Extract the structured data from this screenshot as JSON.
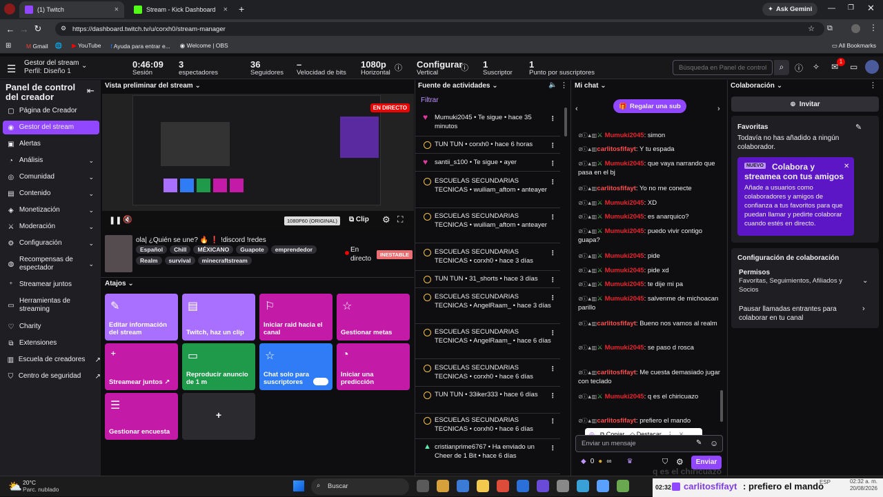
{
  "browser": {
    "tabs": [
      {
        "label": "(1) Twitch"
      },
      {
        "label": "Stream - Kick Dashboard"
      }
    ],
    "new_tab": "+",
    "ask_gemini": "Ask Gemini",
    "url": "https://dashboard.twitch.tv/u/corxh0/stream-manager",
    "bookmarks": [
      "Gmail",
      "YouTube",
      "Ayuda para entrar e...",
      "Welcome | OBS"
    ],
    "all_bookmarks": "All Bookmarks"
  },
  "topbar": {
    "title": "Gestor del stream",
    "profile": "Perfil: Diseño 1",
    "stats": [
      {
        "value": "0:46:09",
        "label": "Sesión"
      },
      {
        "value": "3",
        "label": "espectadores"
      },
      {
        "value": "36",
        "label": "Seguidores"
      },
      {
        "value": "–",
        "label": "Velocidad de bits"
      },
      {
        "value": "1080p",
        "label": "Horizontal"
      },
      {
        "value": "Configurar",
        "label": "Vertical"
      },
      {
        "value": "1",
        "label": "Suscriptor"
      },
      {
        "value": "1",
        "label": "Punto por suscriptores"
      }
    ],
    "search_placeholder": "Búsqueda en Panel de control",
    "notif_count": "1"
  },
  "sidebar": {
    "title": "Panel de control del creador",
    "items": [
      {
        "label": "Página de Creador",
        "icon": "home-icon"
      },
      {
        "label": "Gestor del stream",
        "icon": "broadcast-icon",
        "active": true
      },
      {
        "label": "Alertas",
        "icon": "alert-icon"
      },
      {
        "label": "Análisis",
        "icon": "chart-icon",
        "chevron": true
      },
      {
        "label": "Comunidad",
        "icon": "community-icon",
        "chevron": true
      },
      {
        "label": "Contenido",
        "icon": "content-icon",
        "chevron": true
      },
      {
        "label": "Monetización",
        "icon": "money-icon",
        "chevron": true
      },
      {
        "label": "Moderación",
        "icon": "sword-icon",
        "chevron": true
      },
      {
        "label": "Configuración",
        "icon": "gear-icon",
        "chevron": true
      },
      {
        "label": "Recompensas de espectador",
        "icon": "reward-icon",
        "chevron": true
      },
      {
        "label": "Streamear juntos",
        "icon": "together-icon"
      },
      {
        "label": "Herramientas de streaming",
        "icon": "tools-icon"
      },
      {
        "label": "Charity",
        "icon": "charity-icon"
      },
      {
        "label": "Extensiones",
        "icon": "extensions-icon"
      },
      {
        "label": "Escuela de creadores",
        "icon": "school-icon",
        "external": true
      },
      {
        "label": "Centro de seguridad",
        "icon": "shield-icon",
        "external": true
      }
    ]
  },
  "preview": {
    "header": "Vista preliminar del stream",
    "live_badge": "EN DIRECTO",
    "quality": "1080P60 (ORIGINAL)",
    "clip": "Clip",
    "stream_title": "ola| ¿Quién se une? 🔥 ❗ !discord !redes",
    "tags": [
      "Español",
      "Chill",
      "MÉXICANO",
      "Guapote",
      "emprendedor",
      "Realm",
      "survival",
      "minecraftstream"
    ],
    "status": "En directo",
    "health": "INESTABLE"
  },
  "shortcuts": {
    "header": "Atajos",
    "tiles": [
      {
        "label": "Editar información del stream",
        "color": "#a970ff",
        "icon": "pencil-icon"
      },
      {
        "label": "Twitch, haz un clip",
        "color": "#a970ff",
        "icon": "clapper-icon"
      },
      {
        "label": "Iniciar raid hacia el canal",
        "color": "#c41aa8",
        "icon": "raid-icon"
      },
      {
        "label": "Gestionar metas",
        "color": "#c41aa8",
        "icon": "star-icon"
      },
      {
        "label": "Streamear juntos ↗",
        "color": "#c41aa8",
        "icon": "add-user-icon"
      },
      {
        "label": "Reproducir anuncio de 1 m",
        "color": "#1e9a4a",
        "icon": "ad-icon"
      },
      {
        "label": "Chat solo para suscriptores",
        "color": "#2f7cf6",
        "icon": "star-icon"
      },
      {
        "label": "Iniciar una predicción",
        "color": "#c41aa8",
        "icon": "prediction-icon"
      },
      {
        "label": "Gestionar encuesta",
        "color": "#c41aa8",
        "icon": "poll-icon"
      },
      {
        "label": "+",
        "color": "#2b2b2f",
        "icon": ""
      }
    ]
  },
  "activity": {
    "header": "Fuente de actividades",
    "filter": "Filtrar",
    "items": [
      {
        "text": "Mumuki2045 • Te sigue • hace 35 minutos",
        "type": "follow"
      },
      {
        "text": "TUN TUN • corxh0 • hace 6 horas",
        "type": "circle"
      },
      {
        "text": "santii_s100 • Te sigue • ayer",
        "type": "follow"
      },
      {
        "text": "ESCUELAS SECUNDARIAS TECNICAS • wuiliam_aftom • anteayer",
        "type": "circle"
      },
      {
        "text": "ESCUELAS SECUNDARIAS TECNICAS • wuiliam_aftom • anteayer",
        "type": "circle"
      },
      {
        "text": "ESCUELAS SECUNDARIAS TECNICAS • corxh0 • hace 3 días",
        "type": "circle"
      },
      {
        "text": "TUN TUN • 31_shorts • hace 3 días",
        "type": "circle"
      },
      {
        "text": "ESCUELAS SECUNDARIAS TECNICAS • AngelRaam_ • hace 3 días",
        "type": "circle"
      },
      {
        "text": "ESCUELAS SECUNDARIAS TECNICAS • AngelRaam_ • hace 6 días",
        "type": "circle"
      },
      {
        "text": "ESCUELAS SECUNDARIAS TECNICAS • corxh0 • hace 6 días",
        "type": "circle"
      },
      {
        "text": "TUN TUN • 33iker333 • hace 6 días",
        "type": "circle"
      },
      {
        "text": "ESCUELAS SECUNDARIAS TECNICAS • corxh0 • hace 6 días",
        "type": "circle"
      },
      {
        "text": "cristianprime6767 • Ha enviado un Cheer de 1 Bit • hace 6 días",
        "type": "cheer"
      }
    ]
  },
  "chat": {
    "header": "Mi chat",
    "gift_button": "Regalar una sub",
    "messages": [
      {
        "user": "Mumuki2045",
        "text": "simon"
      },
      {
        "user": "carlitosfifayt",
        "text": "Y tu espada"
      },
      {
        "user": "Mumuki2045",
        "text": "que vaya narrando que pasa en el bj"
      },
      {
        "user": "carlitosfifayt",
        "text": "Yo no me conecte"
      },
      {
        "user": "Mumuki2045",
        "text": "XD"
      },
      {
        "user": "Mumuki2045",
        "text": "es anarquico?"
      },
      {
        "user": "Mumuki2045",
        "text": "puedo vivir contigo guapa?"
      },
      {
        "user": "Mumuki2045",
        "text": "pide"
      },
      {
        "user": "Mumuki2045",
        "text": "pide xd"
      },
      {
        "user": "Mumuki2045",
        "text": "te dije mi pa"
      },
      {
        "user": "Mumuki2045",
        "text": "salvenme de michoacan parillo"
      },
      {
        "user": "carlitosfifayt",
        "text": "Bueno nos vamos al realm"
      },
      {
        "user": "Mumuki2045",
        "text": "se paso d rosca"
      },
      {
        "user": "carlitosfifayt",
        "text": "Me cuesta demasiado jugar con teclado"
      },
      {
        "user": "Mumuki2045",
        "text": "q es el chiricuazo"
      },
      {
        "user": "carlitosfifayt",
        "text": "prefiero el mando"
      }
    ],
    "popup": {
      "copy": "Copiar",
      "highlight": "Destacar"
    },
    "input_placeholder": "Enviar un mensaje",
    "points": "0",
    "send": "Enviar"
  },
  "collab": {
    "header": "Colaboración",
    "invite": "Invitar",
    "favorites_title": "Favoritas",
    "favorites_text": "Todavía no has añadido a ningún colaborador.",
    "promo_badge": "NUEVO",
    "promo_title": "Colabora y streamea con tus amigos",
    "promo_text": "Añade a usuarios como colaboradores y amigos de confianza a tus favoritos para que puedan llamar y pedirte colaborar cuando estés en directo.",
    "config_title": "Configuración de colaboración",
    "perm_title": "Permisos",
    "perm_text": "Favoritas, Seguimientos, Afiliados y Socios",
    "pause_text": "Pausar llamadas entrantes para colaborar en tu canal"
  },
  "taskbar": {
    "temp": "20°C",
    "weather": "Parc. nublado",
    "search": "Buscar",
    "overlay_time": "02:32",
    "overlay_user": "carlitosfifayt",
    "overlay_msg": ": prefiero el mando",
    "overlay_ghost": "q es el chiricuazo",
    "lang": "ESP",
    "time": "02:32 a. m.",
    "date": "20/08/2026"
  }
}
